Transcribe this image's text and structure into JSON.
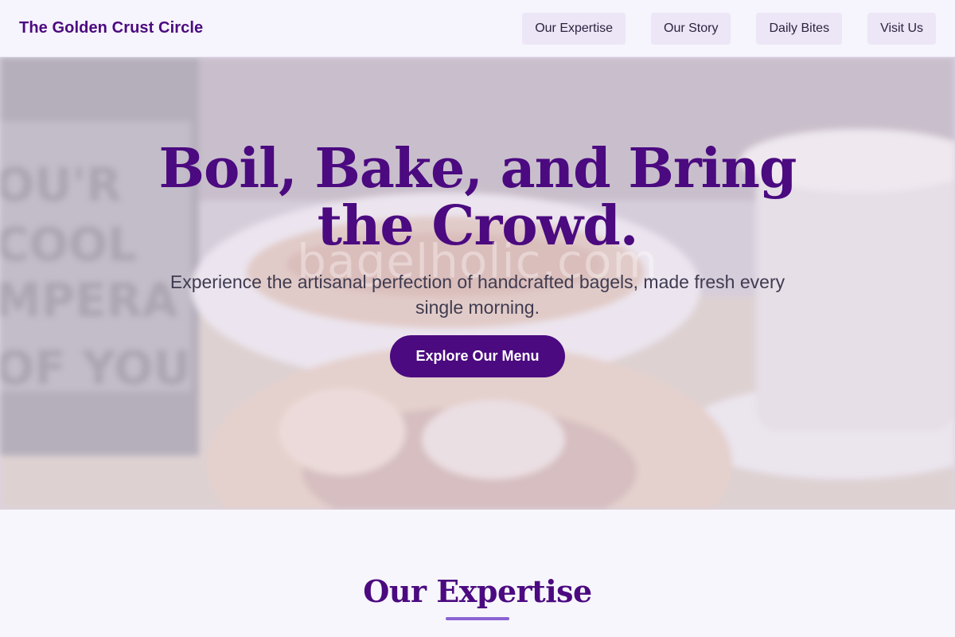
{
  "header": {
    "brand": "The Golden Crust Circle",
    "nav": [
      {
        "label": "Our Expertise"
      },
      {
        "label": "Our Story"
      },
      {
        "label": "Daily Bites"
      },
      {
        "label": "Visit Us"
      }
    ]
  },
  "hero": {
    "title": "Boil, Bake, and Bring the Crowd.",
    "watermark": "bagelholic.com",
    "subtitle": "Experience the artisanal perfection of handcrafted bagels, made fresh every single morning.",
    "cta_label": "Explore Our Menu",
    "background_image": "blurred-cafe-bagel-photo"
  },
  "section": {
    "title": "Our Expertise"
  },
  "colors": {
    "brand": "#4b0a80",
    "nav_bg": "#ece6f6",
    "accent_line": "#8a63d2",
    "page_bg": "#f7f6fc"
  }
}
